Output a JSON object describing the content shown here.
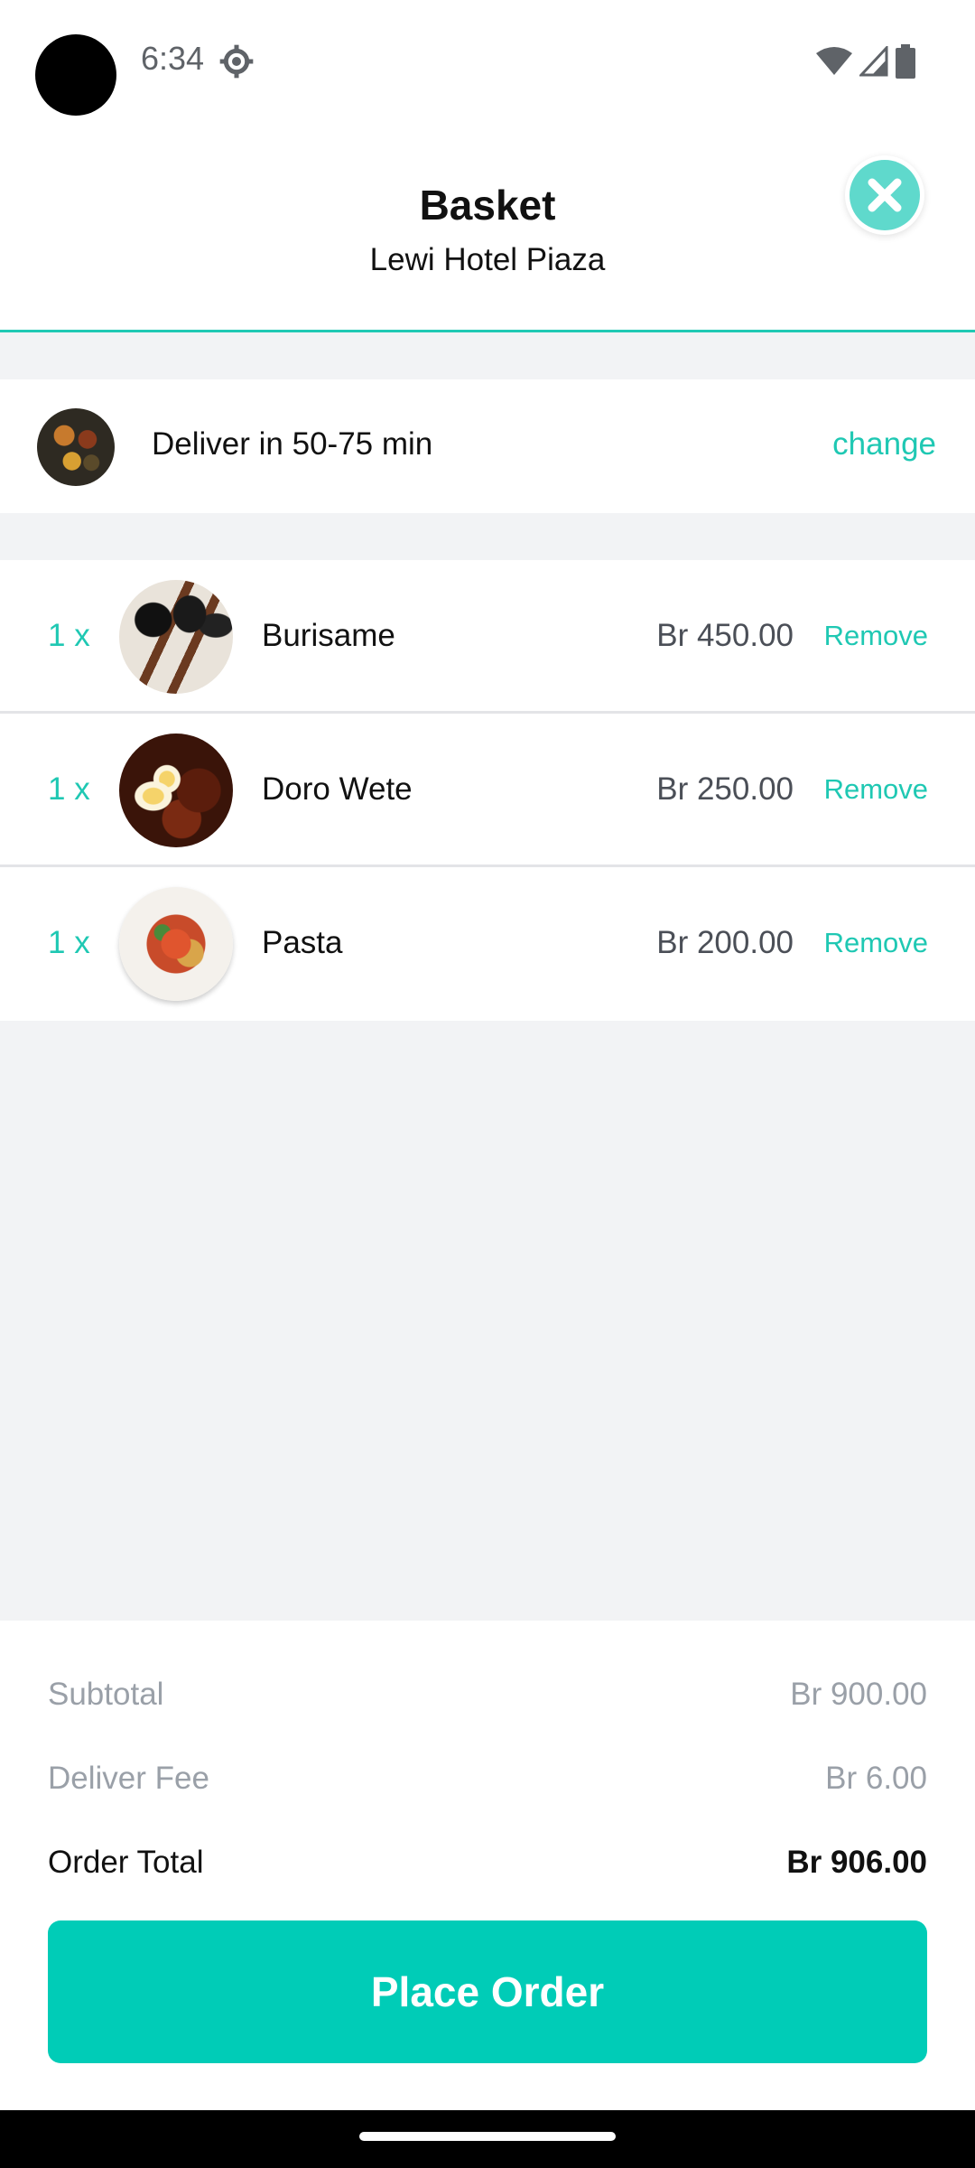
{
  "status_bar": {
    "time": "6:34",
    "icons": [
      "gear-icon",
      "wifi-icon",
      "signal-icon",
      "battery-icon"
    ]
  },
  "header": {
    "title": "Basket",
    "subtitle": "Lewi Hotel Piaza",
    "close_icon": "close-icon"
  },
  "delivery": {
    "text": "Deliver in 50-75 min",
    "change_label": "change"
  },
  "items": [
    {
      "qty": "1 x",
      "name": "Burisame",
      "price": "Br 450.00",
      "remove_label": "Remove"
    },
    {
      "qty": "1 x",
      "name": "Doro Wete",
      "price": "Br 250.00",
      "remove_label": "Remove"
    },
    {
      "qty": "1 x",
      "name": "Pasta",
      "price": "Br 200.00",
      "remove_label": "Remove"
    }
  ],
  "summary": {
    "subtotal_label": "Subtotal",
    "subtotal_value": "Br 900.00",
    "fee_label": "Deliver Fee",
    "fee_value": "Br 6.00",
    "total_label": "Order Total",
    "total_value": "Br 906.00"
  },
  "actions": {
    "place_order_label": "Place Order"
  },
  "colors": {
    "accent": "#00ccb7",
    "accent_text": "#1fc8b3",
    "background": "#f2f3f5"
  }
}
